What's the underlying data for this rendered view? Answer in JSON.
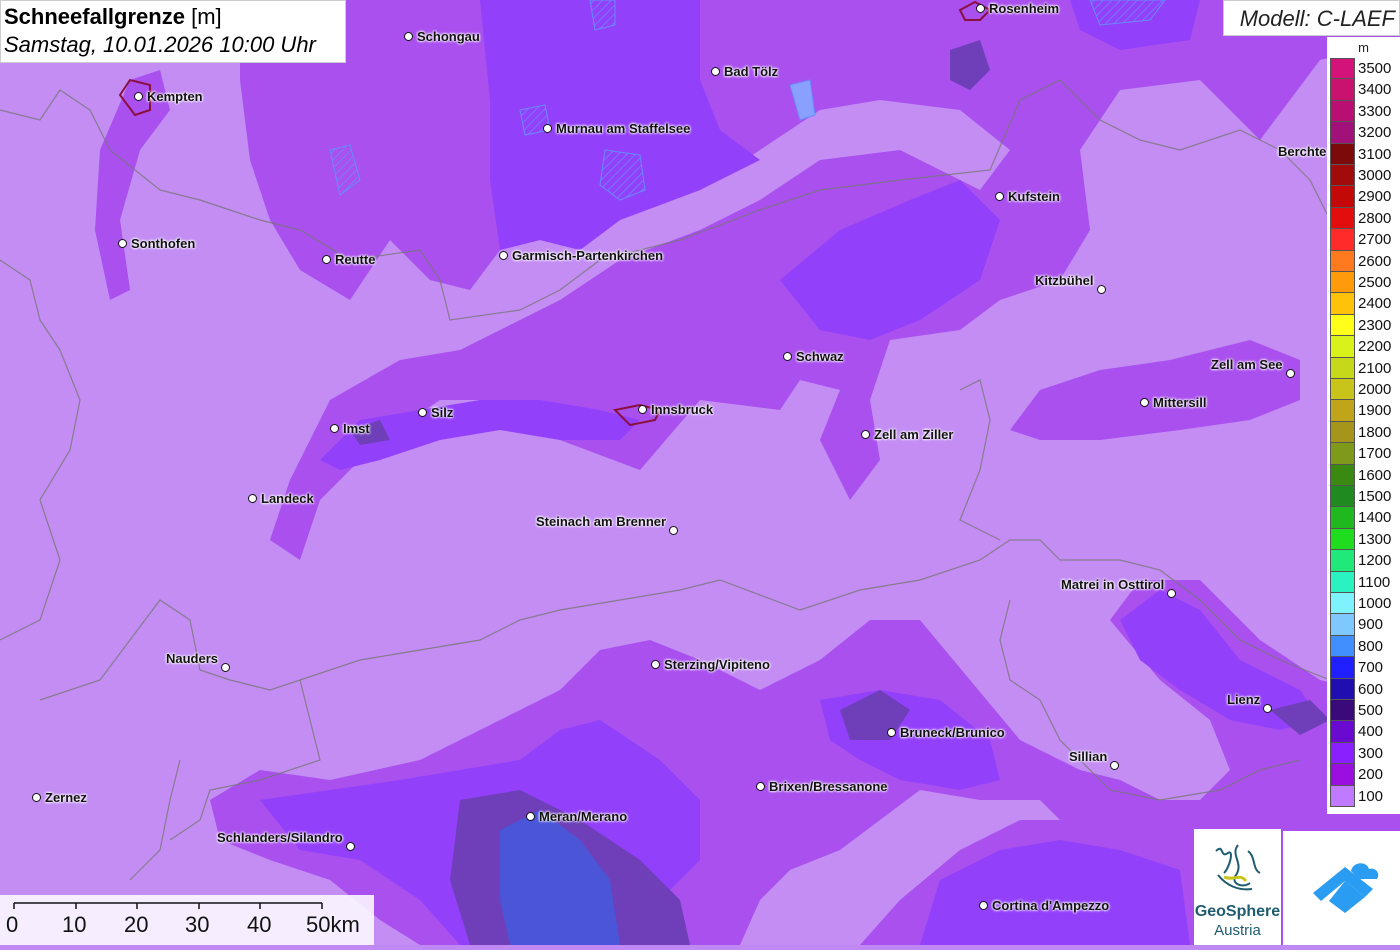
{
  "title": {
    "main": "Schneefallgrenze",
    "unit": "[m]",
    "datetime": "Samstag, 10.01.2026 10:00 Uhr"
  },
  "model": "Modell: C-LAEF",
  "legend": {
    "unit": "m",
    "levels": [
      {
        "label": "3500",
        "color": "#d4137a"
      },
      {
        "label": "3400",
        "color": "#c9126f"
      },
      {
        "label": "3300",
        "color": "#b90e72"
      },
      {
        "label": "3200",
        "color": "#a2107a"
      },
      {
        "label": "3100",
        "color": "#7d0a0a"
      },
      {
        "label": "3000",
        "color": "#a10b0b"
      },
      {
        "label": "2900",
        "color": "#c40707"
      },
      {
        "label": "2800",
        "color": "#e30d0d"
      },
      {
        "label": "2700",
        "color": "#ff2a2a"
      },
      {
        "label": "2600",
        "color": "#ff7a1f"
      },
      {
        "label": "2500",
        "color": "#ff9a0a"
      },
      {
        "label": "2400",
        "color": "#ffc20a"
      },
      {
        "label": "2300",
        "color": "#ffff1a"
      },
      {
        "label": "2200",
        "color": "#d9f21a"
      },
      {
        "label": "2100",
        "color": "#c5d81a"
      },
      {
        "label": "2000",
        "color": "#c8c41a"
      },
      {
        "label": "1900",
        "color": "#c0a41a"
      },
      {
        "label": "1800",
        "color": "#a5951a"
      },
      {
        "label": "1700",
        "color": "#7f9a1a"
      },
      {
        "label": "1600",
        "color": "#3a8a12"
      },
      {
        "label": "1500",
        "color": "#1f8a1f"
      },
      {
        "label": "1400",
        "color": "#1fb81f"
      },
      {
        "label": "1300",
        "color": "#1fdc1f"
      },
      {
        "label": "1200",
        "color": "#21e87a"
      },
      {
        "label": "1100",
        "color": "#2af2c0"
      },
      {
        "label": "1000",
        "color": "#7ff2ff"
      },
      {
        "label": "900",
        "color": "#7fc8ff"
      },
      {
        "label": "800",
        "color": "#3f8fff"
      },
      {
        "label": "700",
        "color": "#1f1fff"
      },
      {
        "label": "600",
        "color": "#1f0fb0"
      },
      {
        "label": "500",
        "color": "#3a0a7a"
      },
      {
        "label": "400",
        "color": "#6a0ad0"
      },
      {
        "label": "300",
        "color": "#8a1fff"
      },
      {
        "label": "200",
        "color": "#9a0fe0"
      },
      {
        "label": "100",
        "color": "#c07aff"
      }
    ]
  },
  "scale": {
    "labels": [
      "0",
      "10",
      "20",
      "30",
      "40",
      "50km"
    ]
  },
  "logos": {
    "geosphere_line1": "GeoSphere",
    "geosphere_line2": "Austria"
  },
  "cities": [
    {
      "name": "Schongau"
    },
    {
      "name": "Rosenheim"
    },
    {
      "name": "Kempten"
    },
    {
      "name": "Bad Tölz"
    },
    {
      "name": "Murnau am Staffelsee"
    },
    {
      "name": "Berchte"
    },
    {
      "name": "Kufstein"
    },
    {
      "name": "Sonthofen"
    },
    {
      "name": "Reutte"
    },
    {
      "name": "Garmisch-Partenkirchen"
    },
    {
      "name": "Kitzbühel"
    },
    {
      "name": "Schwaz"
    },
    {
      "name": "Zell am See"
    },
    {
      "name": "Mittersill"
    },
    {
      "name": "Innsbruck"
    },
    {
      "name": "Silz"
    },
    {
      "name": "Imst"
    },
    {
      "name": "Zell am Ziller"
    },
    {
      "name": "Landeck"
    },
    {
      "name": "Steinach am Brenner"
    },
    {
      "name": "Matrei in Osttirol"
    },
    {
      "name": "Nauders"
    },
    {
      "name": "Sterzing/Vipiteno"
    },
    {
      "name": "Lienz"
    },
    {
      "name": "Bruneck/Brunico"
    },
    {
      "name": "Sillian"
    },
    {
      "name": "Brixen/Bressanone"
    },
    {
      "name": "Zernez"
    },
    {
      "name": "Meran/Merano"
    },
    {
      "name": "Schlanders/Silandro"
    },
    {
      "name": "Cortina d'Ampezzo"
    }
  ]
}
